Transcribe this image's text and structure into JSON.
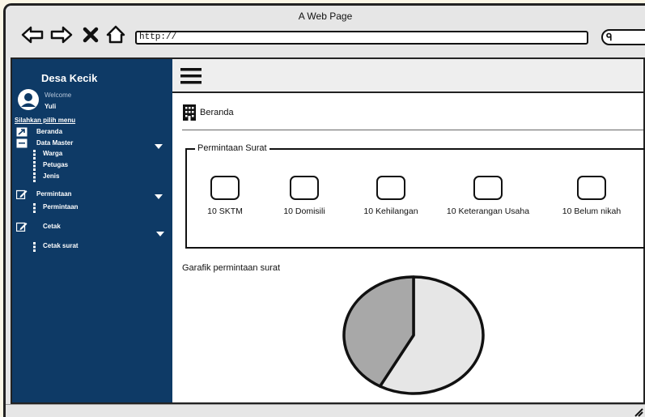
{
  "window": {
    "title": "A Web Page"
  },
  "addressbar": {
    "url": "http://"
  },
  "colors": {
    "sidebar_bg": "#0e3a66",
    "pie_slice_1": "#e6e6e6",
    "pie_slice_2": "#a8a8a8"
  },
  "sidebar": {
    "brand": "Desa Kecik",
    "welcome": "Welcome",
    "username": "Yuli",
    "menu_heading": "Silahkan pilih menu",
    "items": [
      {
        "label": "Beranda",
        "icon": "arrow-icon"
      },
      {
        "label": "Data Master",
        "icon": "folder-icon"
      },
      {
        "label": "Warga",
        "icon": "dots-icon"
      },
      {
        "label": "Petugas",
        "icon": "dots-icon"
      },
      {
        "label": "Jenis",
        "icon": "dots-icon"
      },
      {
        "label": "Permintaan",
        "icon": "edit-icon"
      },
      {
        "label": "Permintaan",
        "icon": "dots-icon"
      },
      {
        "label": "Cetak",
        "icon": "edit-icon"
      },
      {
        "label": "Cetak surat",
        "icon": "dots-icon"
      }
    ]
  },
  "main": {
    "breadcrumb": "Beranda",
    "section_title": "Permintaan Surat",
    "stats": [
      {
        "label": "10 SKTM"
      },
      {
        "label": "10 Domisili"
      },
      {
        "label": "10 Kehilangan"
      },
      {
        "label": "10 Keterangan Usaha"
      },
      {
        "label": "10 Belum nikah"
      }
    ],
    "chart_title": "Garafik permintaan surat"
  },
  "chart_data": {
    "type": "pie",
    "values": [
      58,
      42
    ],
    "colors": [
      "#e6e6e6",
      "#a8a8a8"
    ]
  }
}
